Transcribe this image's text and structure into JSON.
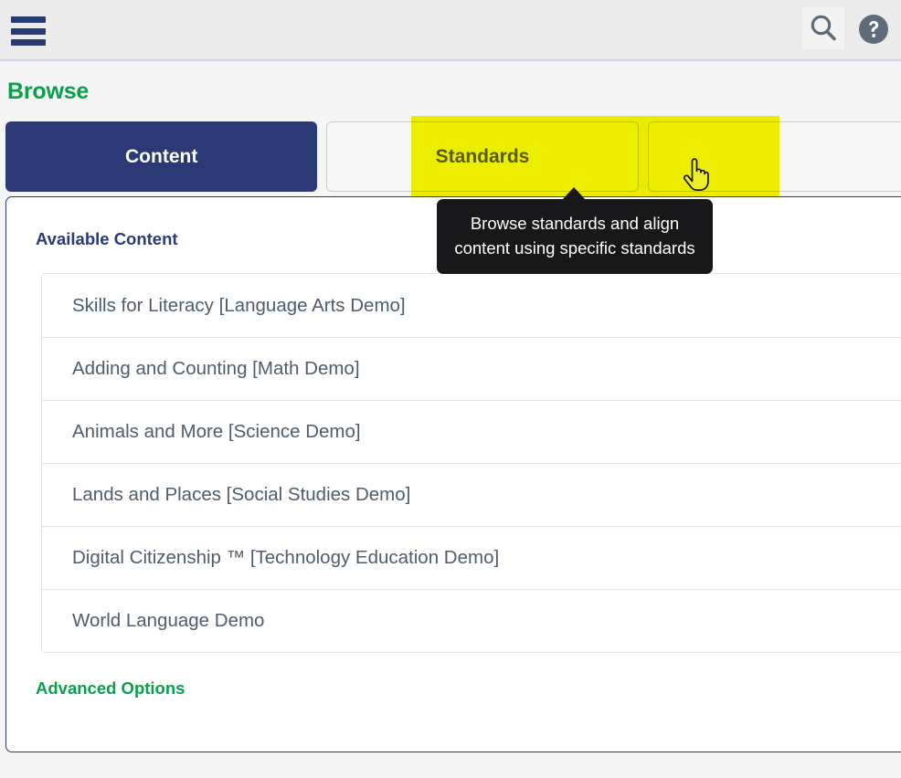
{
  "app_bar": {
    "menu_icon": "hamburger-menu-icon",
    "search_icon": "search-icon",
    "help_icon": "help-question-circle-icon"
  },
  "page": {
    "title": "Browse"
  },
  "tabs": [
    {
      "label": "Content",
      "state": "active"
    },
    {
      "label": "Standards",
      "state": "inactive"
    },
    {
      "label": "",
      "state": "inactive"
    }
  ],
  "highlight": {
    "color": "#f5f500",
    "target": "Standards"
  },
  "tooltip": {
    "text": "Browse standards and align content using specific standards",
    "background": "#18181a",
    "text_color": "#ffffff"
  },
  "main": {
    "heading": "Available Content",
    "items": [
      "Skills for Literacy [Language Arts Demo]",
      "Adding and Counting [Math Demo]",
      "Animals and More [Science Demo]",
      "Lands and Places [Social Studies Demo]",
      "Digital Citizenship ™ [Technology Education Demo]",
      "World Language Demo"
    ],
    "advanced_options": "Advanced Options"
  },
  "colors": {
    "navy": "#2b3a76",
    "green": "#08a04b",
    "slate_text": "#4f5c6b",
    "app_bar_bg": "#ebebeb",
    "page_bg": "#f5f5f6",
    "highlight_yellow": "#f5f500"
  }
}
